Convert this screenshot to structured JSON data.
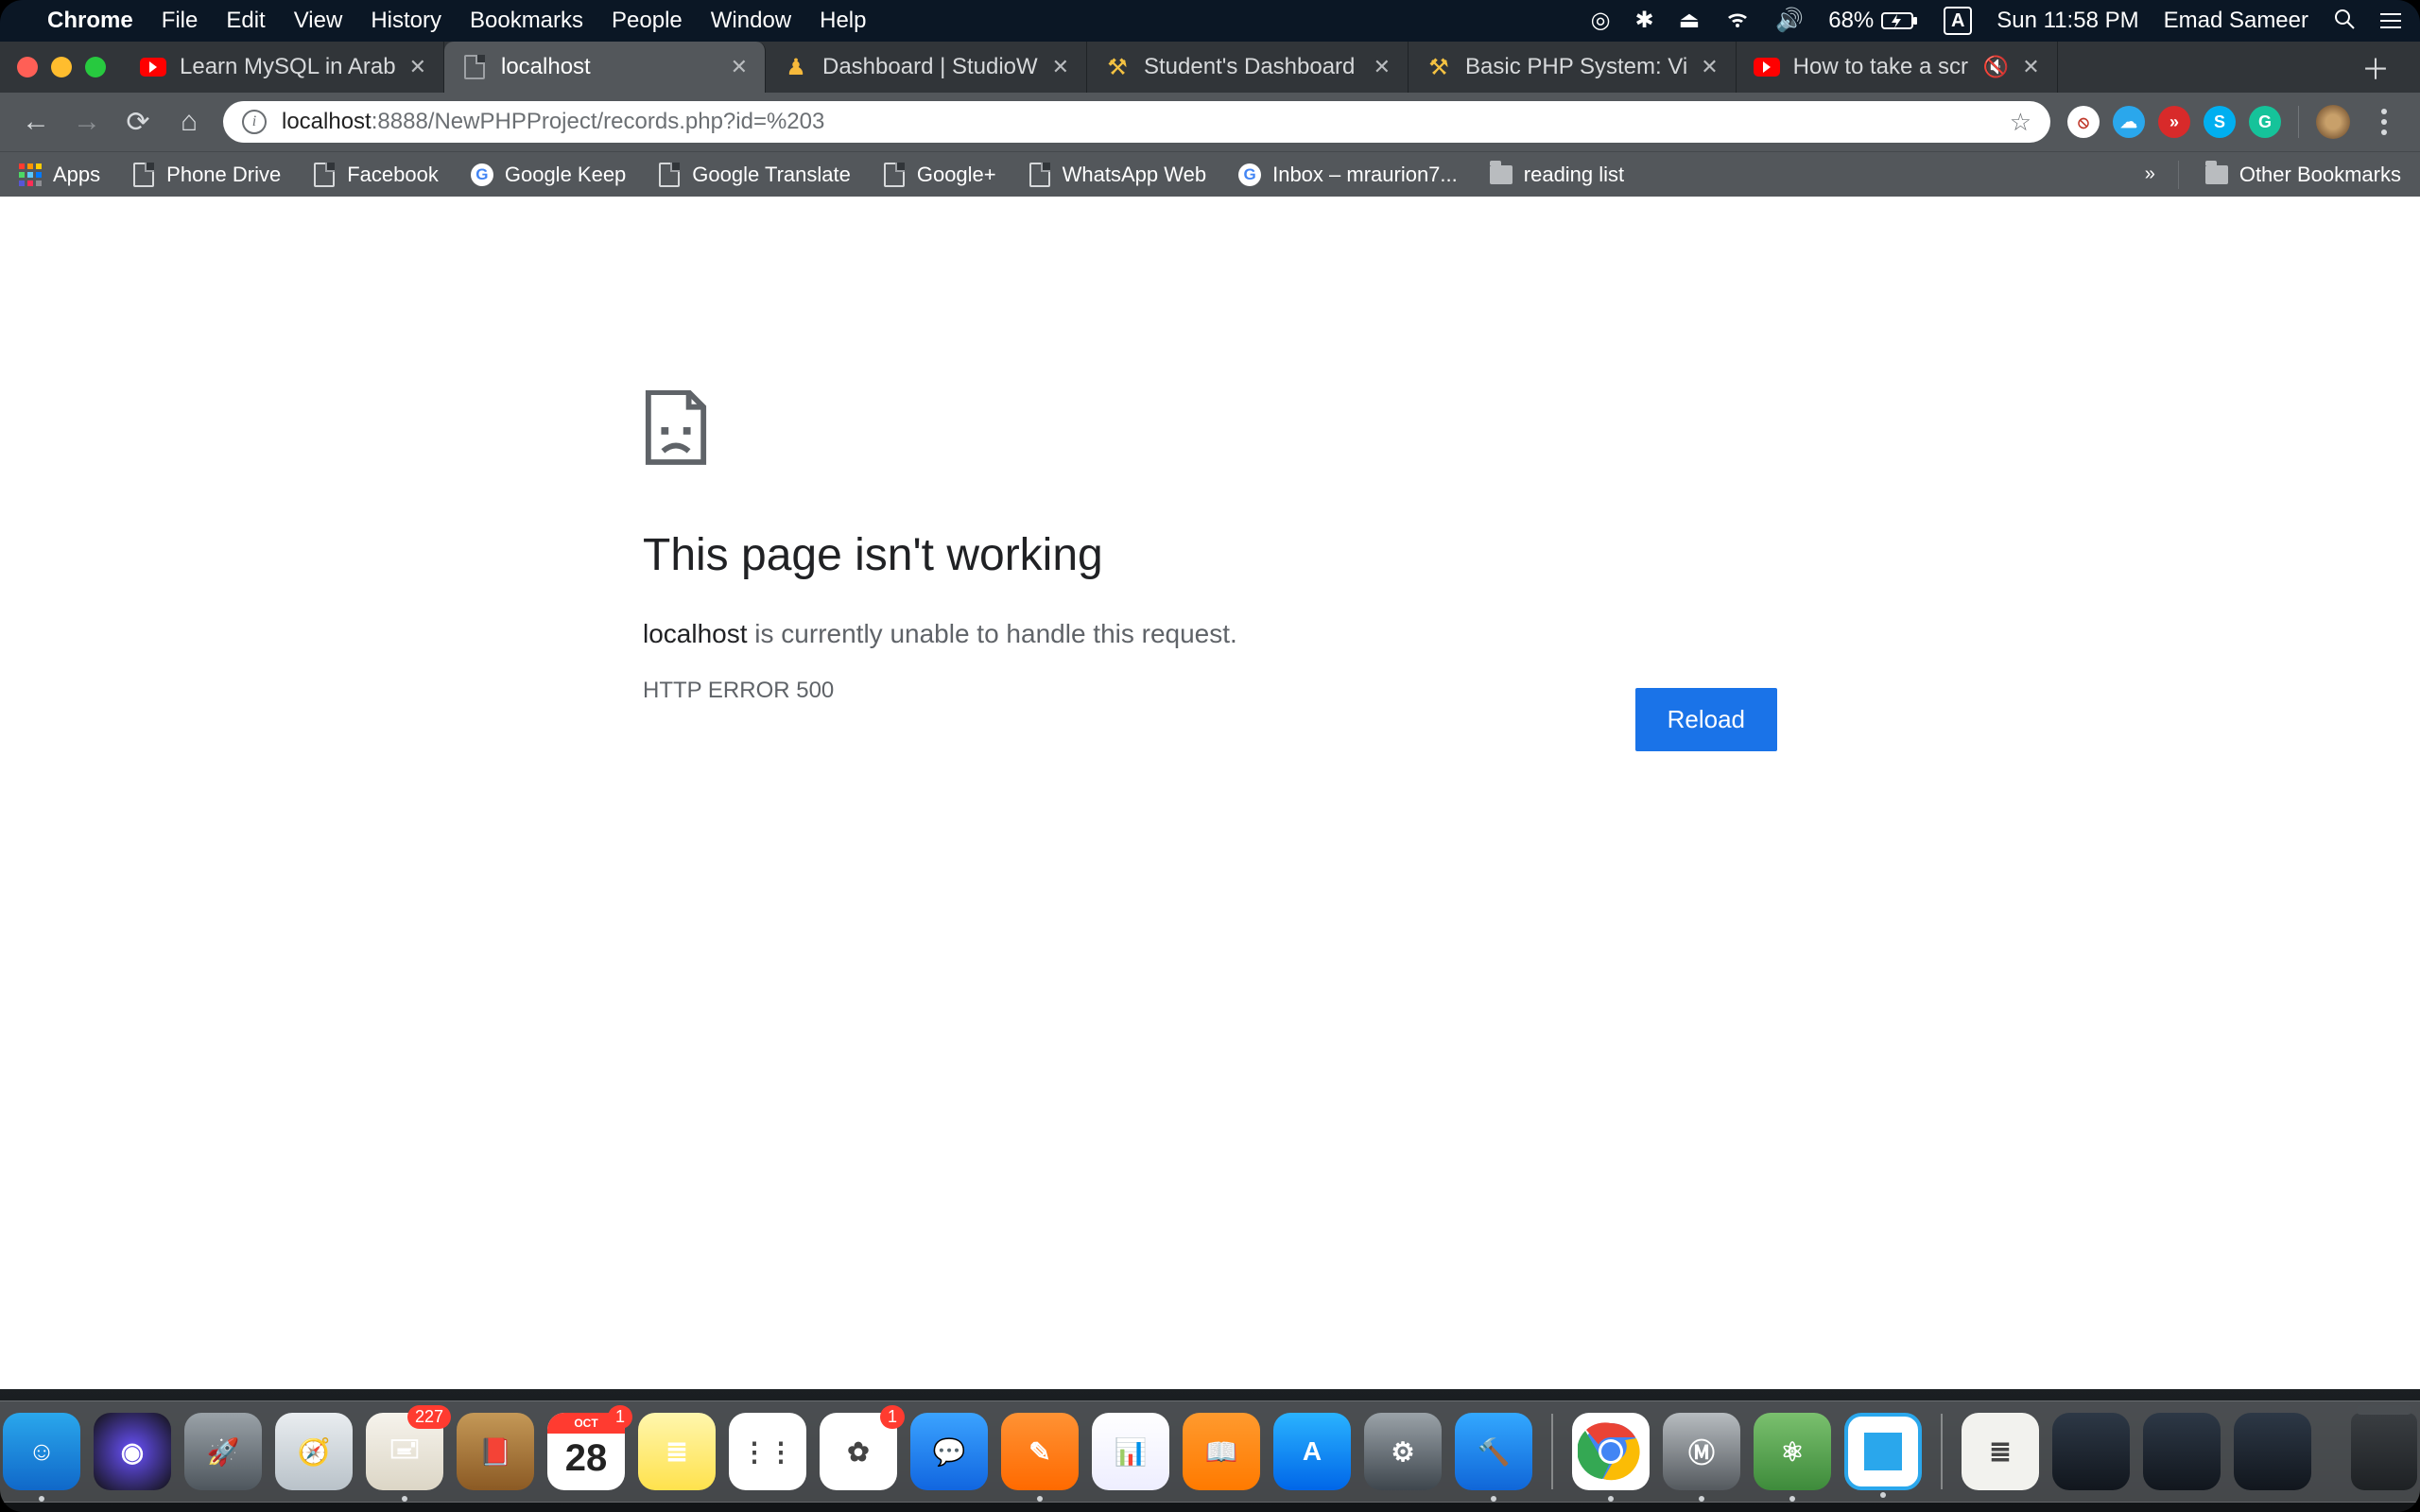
{
  "menubar": {
    "app": "Chrome",
    "items": [
      "File",
      "Edit",
      "View",
      "History",
      "Bookmarks",
      "People",
      "Window",
      "Help"
    ],
    "battery": "68%",
    "clock": "Sun 11:58 PM",
    "user": "Emad Sameer",
    "input_indicator": "A"
  },
  "tabs": [
    {
      "title": "Learn MySQL in Arab",
      "icon": "youtube",
      "active": false,
      "muted": false
    },
    {
      "title": "localhost",
      "icon": "document",
      "active": true,
      "muted": false
    },
    {
      "title": "Dashboard | StudioW",
      "icon": "bulb",
      "active": false,
      "muted": false
    },
    {
      "title": "Student's Dashboard",
      "icon": "hammer",
      "active": false,
      "muted": false
    },
    {
      "title": "Basic PHP System: Vi",
      "icon": "hammer",
      "active": false,
      "muted": false
    },
    {
      "title": "How to take a scr",
      "icon": "youtube",
      "active": false,
      "muted": true
    }
  ],
  "url": {
    "host": "localhost",
    "rest": ":8888/NewPHPProject/records.php?id=%203"
  },
  "extensions": [
    {
      "name": "ublock",
      "bg": "#ffffff",
      "fg": "#c0392b",
      "glyph": "⦸"
    },
    {
      "name": "cloud",
      "bg": "#2aa7ec",
      "fg": "#ffffff",
      "glyph": "☁"
    },
    {
      "name": "player",
      "bg": "#d82a2a",
      "fg": "#ffffff",
      "glyph": "»"
    },
    {
      "name": "skype",
      "bg": "#00aff0",
      "fg": "#ffffff",
      "glyph": "S"
    },
    {
      "name": "grammarly",
      "bg": "#15c39a",
      "fg": "#ffffff",
      "glyph": "G"
    }
  ],
  "bookmarks": [
    {
      "label": "Apps",
      "icon": "apps"
    },
    {
      "label": "Phone Drive",
      "icon": "doc"
    },
    {
      "label": "Facebook",
      "icon": "doc"
    },
    {
      "label": "Google Keep",
      "icon": "google"
    },
    {
      "label": "Google Translate",
      "icon": "doc"
    },
    {
      "label": "Google+",
      "icon": "doc"
    },
    {
      "label": "WhatsApp Web",
      "icon": "doc"
    },
    {
      "label": "Inbox – mraurion7...",
      "icon": "google"
    },
    {
      "label": "reading list",
      "icon": "folder"
    }
  ],
  "other_bookmarks": "Other Bookmarks",
  "error": {
    "heading": "This page isn't working",
    "host": "localhost",
    "message": " is currently unable to handle this request.",
    "code": "HTTP ERROR 500",
    "reload": "Reload"
  },
  "dock": {
    "items": [
      {
        "name": "finder",
        "bg": "linear-gradient(#2aa7ec,#1068c9)",
        "glyph": "☺",
        "running": true
      },
      {
        "name": "siri",
        "bg": "radial-gradient(circle,#6a52ff,#111)",
        "glyph": "◉",
        "running": false
      },
      {
        "name": "launchpad",
        "bg": "linear-gradient(#9aa2a8,#4e565d)",
        "glyph": "🚀",
        "running": false
      },
      {
        "name": "safari",
        "bg": "linear-gradient(#e9edf0,#b9c2c9)",
        "glyph": "🧭",
        "running": false
      },
      {
        "name": "mail",
        "bg": "linear-gradient(#f6f3ec,#dcd6c6)",
        "glyph": "🖃",
        "running": true,
        "badge": "227"
      },
      {
        "name": "contacts",
        "bg": "linear-gradient(#c49857,#8b5a24)",
        "glyph": "📕",
        "running": false
      },
      {
        "name": "calendar",
        "bg": "#ffffff",
        "glyph": "28",
        "running": false,
        "badge": "1",
        "sub": "OCT"
      },
      {
        "name": "notes",
        "bg": "linear-gradient(#fff6ad,#ffe24d)",
        "glyph": "≣",
        "running": false
      },
      {
        "name": "reminders",
        "bg": "#ffffff",
        "glyph": "⋮⋮",
        "running": false
      },
      {
        "name": "photos",
        "bg": "#ffffff",
        "glyph": "✿",
        "running": false,
        "badge": "1"
      },
      {
        "name": "messages",
        "bg": "linear-gradient(#3ba3ff,#1166e0)",
        "glyph": "💬",
        "running": false
      },
      {
        "name": "pages",
        "bg": "linear-gradient(#ff9234,#ff6a00)",
        "glyph": "✎",
        "running": true
      },
      {
        "name": "numbers",
        "bg": "linear-gradient(#fff,#eef)",
        "glyph": "📊",
        "running": false
      },
      {
        "name": "ibooks",
        "bg": "linear-gradient(#ff9a2e,#ff7a00)",
        "glyph": "📖",
        "running": false
      },
      {
        "name": "appstore",
        "bg": "linear-gradient(#2ab3ff,#0066e8)",
        "glyph": "A",
        "running": false
      },
      {
        "name": "preferences",
        "bg": "linear-gradient(#9aa2a8,#3e464d)",
        "glyph": "⚙",
        "running": false
      },
      {
        "name": "xcode",
        "bg": "linear-gradient(#33a8ff,#1066d8)",
        "glyph": "🔨",
        "running": true
      }
    ],
    "items2": [
      {
        "name": "chrome",
        "bg": "#ffffff",
        "glyph": "◯",
        "running": true
      },
      {
        "name": "mamp",
        "bg": "linear-gradient(#b7bcc0,#54595e)",
        "glyph": "Ⓜ",
        "running": true
      },
      {
        "name": "atom",
        "bg": "linear-gradient(#7ac06e,#3e8b3b)",
        "glyph": "⚛",
        "running": true
      },
      {
        "name": "brackets",
        "bg": "#ffffff",
        "glyph": "▣",
        "running": true
      }
    ],
    "items3": [
      {
        "name": "textedit-doc",
        "bg": "#f2f2ee",
        "glyph": "≣"
      },
      {
        "name": "folder-1",
        "bg": "linear-gradient(#2d3846,#11161d)",
        "glyph": ""
      },
      {
        "name": "folder-2",
        "bg": "linear-gradient(#2d3846,#11161d)",
        "glyph": ""
      },
      {
        "name": "folder-3",
        "bg": "linear-gradient(#2d3846,#11161d)",
        "glyph": ""
      }
    ]
  }
}
